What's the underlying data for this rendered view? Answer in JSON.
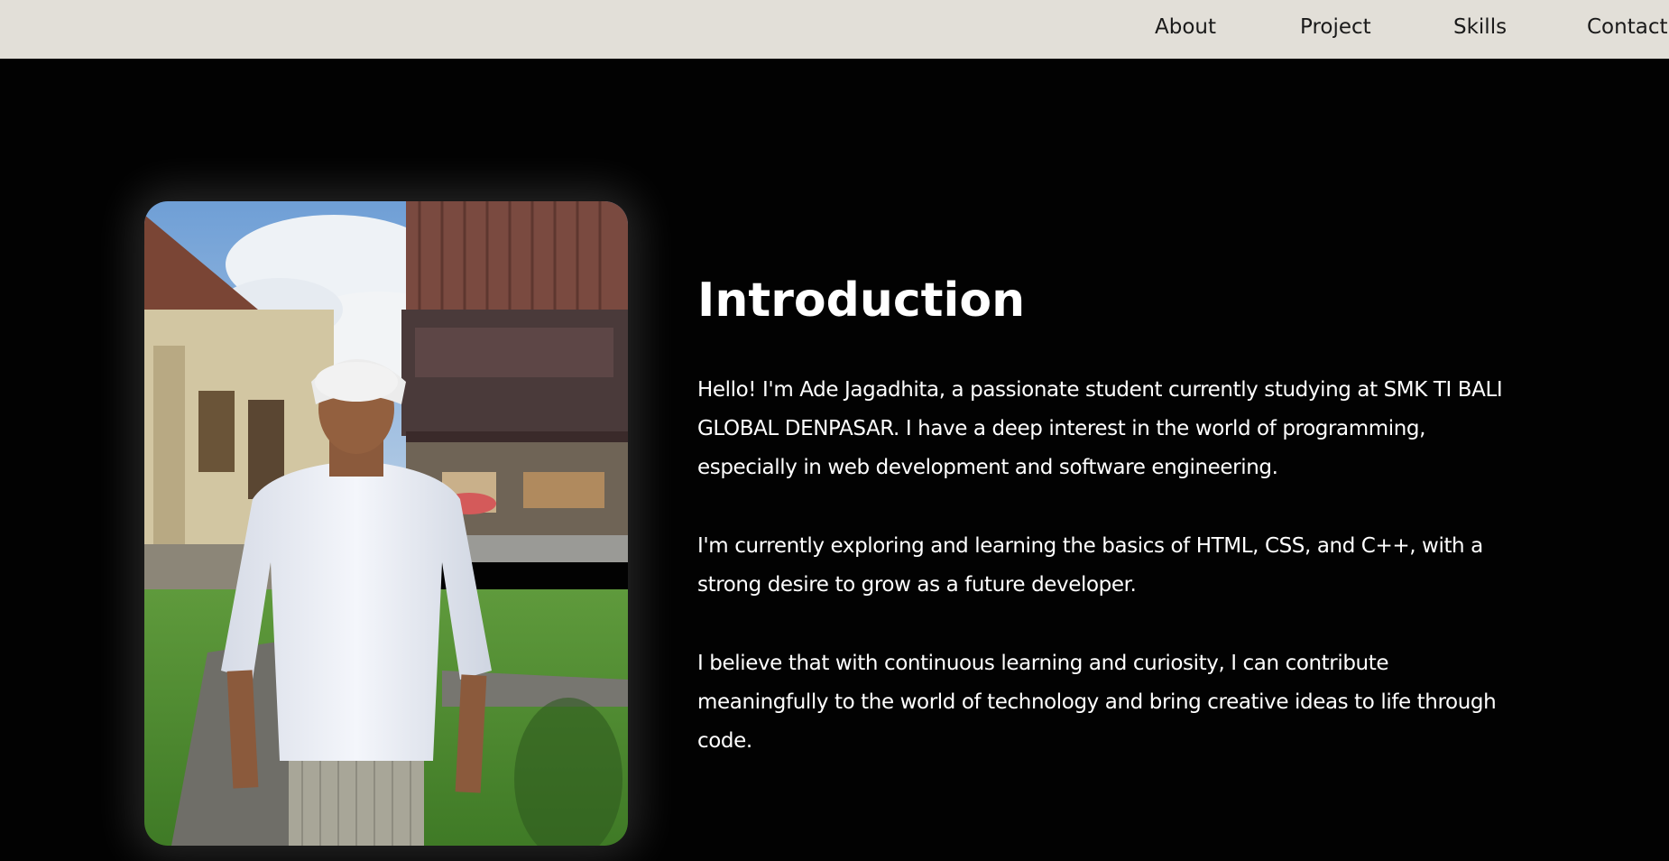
{
  "nav": {
    "about": "About",
    "project": "Project",
    "skills": "Skills",
    "contact": "Contact"
  },
  "intro": {
    "title": "Introduction",
    "para1": "Hello! I'm Ade Jagadhita, a passionate student currently studying at SMK TI BALI GLOBAL DENPASAR. I have a deep interest in the world of programming, especially in web development and software engineering.",
    "para2": "I'm currently exploring and learning the basics of HTML, CSS, and C++, with a strong desire to grow as a future developer.",
    "para3": "I believe that with continuous learning and curiosity, I can contribute meaningfully to the world of technology and bring creative ideas to life through code."
  },
  "colors": {
    "nav_background": "#e2dfd8",
    "page_background": "#020202",
    "text": "#ffffff"
  }
}
